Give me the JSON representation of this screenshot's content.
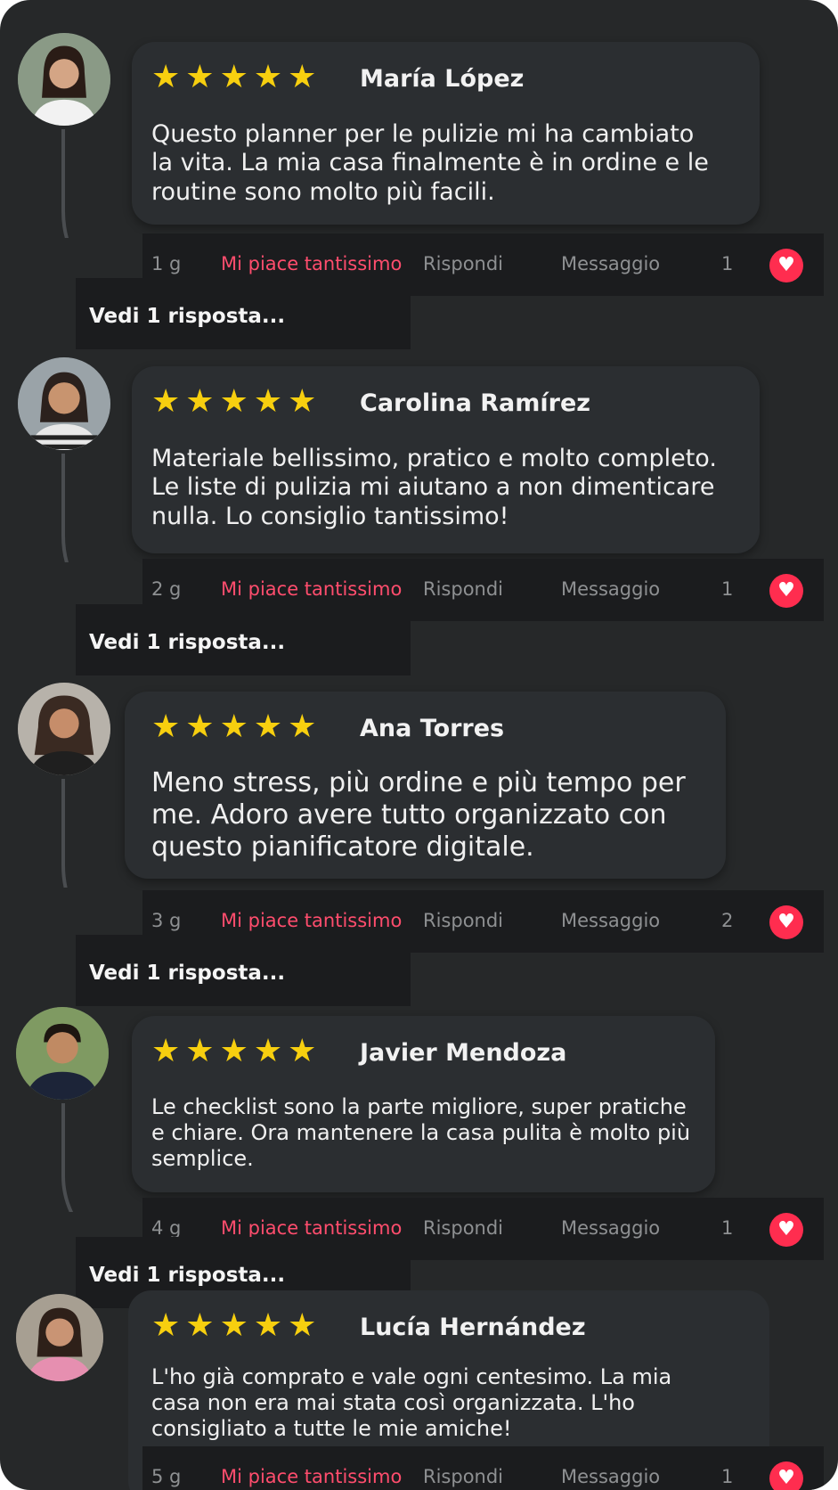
{
  "colors": {
    "background": "#262829",
    "bubble": "#2b2e31",
    "actions_bar": "#1b1c1e",
    "star": "#f7cf0f",
    "like_text": "#ff4d6d",
    "heart": "#ff2d4f"
  },
  "reviews": [
    {
      "name": "María López",
      "rating": 5,
      "text": "Questo planner per le pulizie mi ha cambiato la vita. La mia casa finalmente è in ordine e le routine sono molto più facili.",
      "time": "1 g",
      "like_label": "Mi piace tantissimo",
      "reply_label": "Rispondi",
      "message_label": "Messaggio",
      "like_count": "1",
      "view_replies": "Vedi 1 risposta..."
    },
    {
      "name": "Carolina Ramírez",
      "rating": 5,
      "text": "Materiale bellissimo, pratico e molto completo. Le liste di pulizia mi aiutano a non dimenticare nulla. Lo consiglio tantissimo!",
      "time": "2 g",
      "like_label": "Mi piace tantissimo",
      "reply_label": "Rispondi",
      "message_label": "Messaggio",
      "like_count": "1",
      "view_replies": "Vedi 1 risposta..."
    },
    {
      "name": "Ana Torres",
      "rating": 5,
      "text": "Meno stress, più ordine e più tempo per me. Adoro avere tutto organizzato con questo pianificatore digitale.",
      "time": "3 g",
      "like_label": "Mi piace tantissimo",
      "reply_label": "Rispondi",
      "message_label": "Messaggio",
      "like_count": "2",
      "view_replies": "Vedi 1 risposta..."
    },
    {
      "name": "Javier Mendoza",
      "rating": 5,
      "text": "Le checklist sono la parte migliore, super pratiche e chiare. Ora mantenere la casa pulita è molto più semplice.",
      "time": "4 g",
      "like_label": "Mi piace tantissimo",
      "reply_label": "Rispondi",
      "message_label": "Messaggio",
      "like_count": "1",
      "view_replies": "Vedi 1 risposta..."
    },
    {
      "name": "Lucía Hernández",
      "rating": 5,
      "text": "L'ho già comprato e vale ogni centesimo. La mia casa non era mai stata così organizzata. L'ho consigliato a tutte le mie amiche!",
      "time": "5 g",
      "like_label": "Mi piace tantissimo",
      "reply_label": "Rispondi",
      "message_label": "Messaggio",
      "like_count": "1"
    }
  ]
}
